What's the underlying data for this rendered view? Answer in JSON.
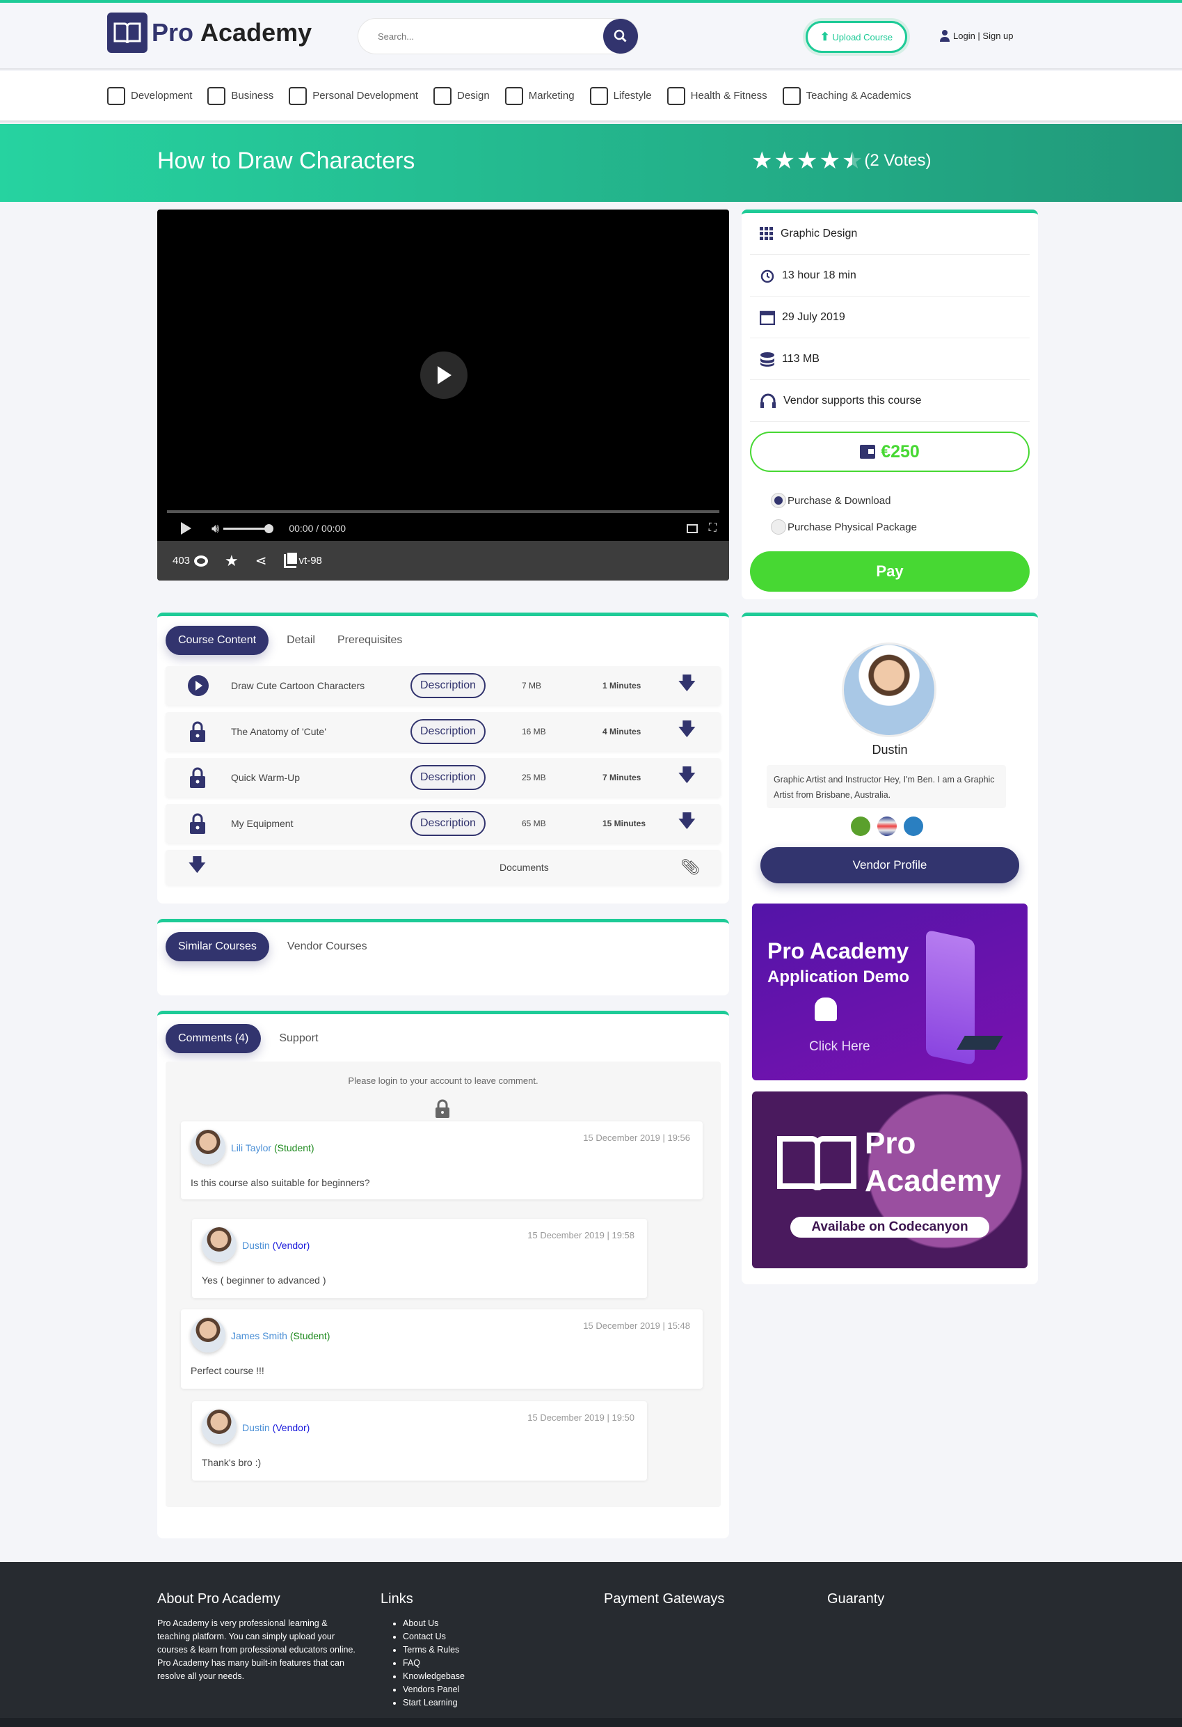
{
  "header": {
    "logo": "Pro Academy",
    "logo_part1": "Pro",
    "logo_part2": "Academy",
    "search_placeholder": "Search...",
    "upload": "Upload Course",
    "login": "Login | Sign up"
  },
  "nav": [
    {
      "label": "Development",
      "icon": "development-icon"
    },
    {
      "label": "Business",
      "icon": "business-chart-icon"
    },
    {
      "label": "Personal Development",
      "icon": "book-icon"
    },
    {
      "label": "Design",
      "icon": "design-tools-icon"
    },
    {
      "label": "Marketing",
      "icon": "target-icon"
    },
    {
      "label": "Lifestyle",
      "icon": "lifestyle-icon"
    },
    {
      "label": "Health & Fitness",
      "icon": "stethoscope-icon"
    },
    {
      "label": "Teaching & Academics",
      "icon": "certificate-icon"
    }
  ],
  "hero": {
    "title": "How to Draw Characters",
    "rating": 4.5,
    "votes": "(2 Votes)"
  },
  "video": {
    "time": "00:00 / 00:00",
    "views": "403",
    "code": "vt-98",
    "volume": 0.85
  },
  "info": {
    "category": "Graphic Design",
    "duration": "13 hour 18 min",
    "date": "29 July 2019",
    "size": "113 MB",
    "support": "Vendor supports this course",
    "price": "€250",
    "options": [
      "Purchase & Download",
      "Purchase Physical Package"
    ],
    "pay": "Pay"
  },
  "content": {
    "tabs": [
      "Course Content",
      "Detail",
      "Prerequisites"
    ],
    "lessons": [
      {
        "title": "Draw Cute Cartoon Characters",
        "button": "Description",
        "size": "7 MB",
        "duration": "1 Minutes",
        "locked": false
      },
      {
        "title": "The Anatomy of 'Cute'",
        "button": "Description",
        "size": "16 MB",
        "duration": "4 Minutes",
        "locked": true
      },
      {
        "title": "Quick Warm-Up",
        "button": "Description",
        "size": "25 MB",
        "duration": "7 Minutes",
        "locked": true
      },
      {
        "title": "My Equipment",
        "button": "Description",
        "size": "65 MB",
        "duration": "15 Minutes",
        "locked": true
      }
    ],
    "documents": "Documents"
  },
  "similar": {
    "tabs": [
      "Similar Courses",
      "Vendor Courses"
    ]
  },
  "comments": {
    "tabs": [
      "Comments (4)",
      "Support"
    ],
    "login_note": "Please login to your account to leave comment.",
    "items": [
      {
        "name": "Lili Taylor",
        "role": "(Student)",
        "time": "15 December 2019 | 19:56",
        "text": "Is this course also suitable for beginners?"
      },
      {
        "name": "Dustin",
        "role": "(Vendor)",
        "time": "15 December 2019 | 19:58",
        "text": "Yes ( beginner to advanced )"
      },
      {
        "name": "James Smith",
        "role": "(Student)",
        "time": "15 December 2019 | 15:48",
        "text": "Perfect course !!!"
      },
      {
        "name": "Dustin",
        "role": "(Vendor)",
        "time": "15 December 2019 | 19:50",
        "text": "Thank's bro :)"
      }
    ]
  },
  "vendor": {
    "name": "Dustin",
    "bio": "Graphic Artist and Instructor Hey, I'm Ben. I am a Graphic Artist from Brisbane, Australia.",
    "button": "Vendor Profile",
    "banner1": {
      "title": "Pro Academy",
      "subtitle": "Application Demo",
      "cta": "Click Here"
    },
    "banner2": {
      "line1": "Pro",
      "line2": "Academy",
      "pill": "Availabe on Codecanyon"
    }
  },
  "footer": {
    "about_title": "About Pro Academy",
    "about_text": "Pro Academy is very professional learning & teaching platform. You can simply upload your courses & learn from professional educators online. Pro Academy has many built-in features that can resolve all your needs.",
    "links_title": "Links",
    "links": [
      "About Us",
      "Contact Us",
      "Terms & Rules",
      "FAQ",
      "Knowledgebase",
      "Vendors Panel",
      "Start Learning"
    ],
    "payment_title": "Payment Gateways",
    "guaranty_title": "Guaranty"
  },
  "colors": {
    "accent": "#1ecb97",
    "primary": "#32346e",
    "price": "#47d833",
    "footer": "#272b30"
  }
}
